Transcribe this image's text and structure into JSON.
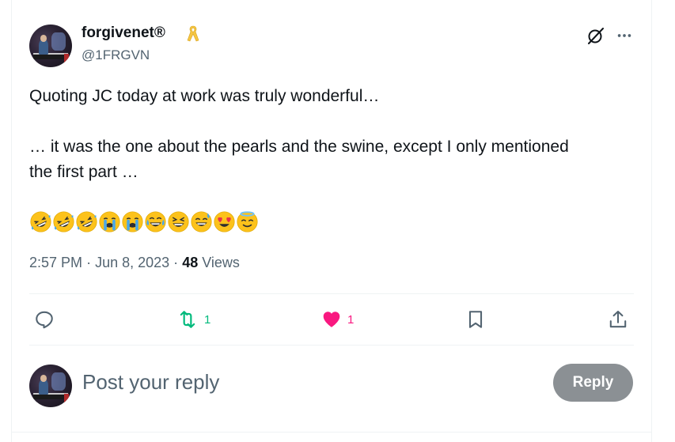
{
  "tweet": {
    "author": {
      "display_name": "forgivenet®",
      "handle": "@1FRGVN",
      "badge_icon": "yellow-ribbon-icon",
      "avatar_icon": "avatar-pianist-image"
    },
    "header_icons": [
      "grok-icon",
      "more-icon"
    ],
    "text_lines": [
      "Quoting JC today at work was truly wonderful…",
      "",
      "… it was the one about the pearls and the swine, except I only mentioned",
      "the first part …"
    ],
    "emojis": [
      "🤣",
      "🤣",
      "🤣",
      "😭",
      "😭",
      "😂",
      "😆",
      "😅",
      "😍",
      "😇"
    ],
    "meta": {
      "time": "2:57 PM",
      "separator": "·",
      "date": "Jun 8, 2023",
      "views_count": "48",
      "views_label": "Views"
    },
    "actions": {
      "reply_icon": "reply-icon",
      "retweet_icon": "retweet-icon",
      "retweet_count": "1",
      "like_icon": "heart-icon",
      "like_count": "1",
      "bookmark_icon": "bookmark-icon",
      "share_icon": "share-icon"
    }
  },
  "reply_box": {
    "placeholder": "Post your reply",
    "button_label": "Reply"
  },
  "colors": {
    "retweet_active": "#00ba7c",
    "like_active": "#f91880",
    "secondary_text": "#536471",
    "reply_button_bg": "#8b9094"
  }
}
